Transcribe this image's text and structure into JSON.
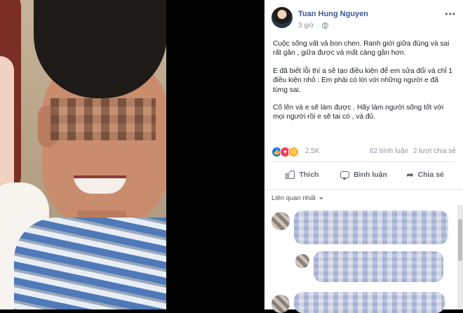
{
  "post": {
    "author": "Tuan Hung Nguyen",
    "time": "3 giờ",
    "visibility_icon": "globe-icon",
    "more_icon": "ellipsis-icon",
    "paragraphs": [
      "Cuộc sống vất vả bon chen. Ranh giới giữa đúng và sai rất gần , giữa được và mất càng gần hơn.",
      "E đã biết lỗi thì a sẽ tạo điều kiện để em sửa đổi và chỉ 1 điều kiện nhỏ : Em phải có lời với những người e đã từng sai.",
      "Cố lên và e sẽ làm được . Hãy làm người sống tốt với mọi người rồi e sẽ tai có , và đủ."
    ],
    "reactions_count": "2,5K",
    "comments_count": "62 bình luận",
    "shares_count": "2 lượt chia sẻ",
    "reaction_types": [
      "like",
      "love",
      "sad"
    ]
  },
  "actions": {
    "like_label": "Thích",
    "comment_label": "Bình luận",
    "share_label": "Chia sẻ"
  },
  "sort": {
    "label": "Liên quan nhất"
  },
  "colors": {
    "author_link": "#365899",
    "meta_text": "#90949c",
    "like_blue": "#1877f2",
    "love_red": "#f33e58",
    "sad_yellow": "#f7b125"
  }
}
